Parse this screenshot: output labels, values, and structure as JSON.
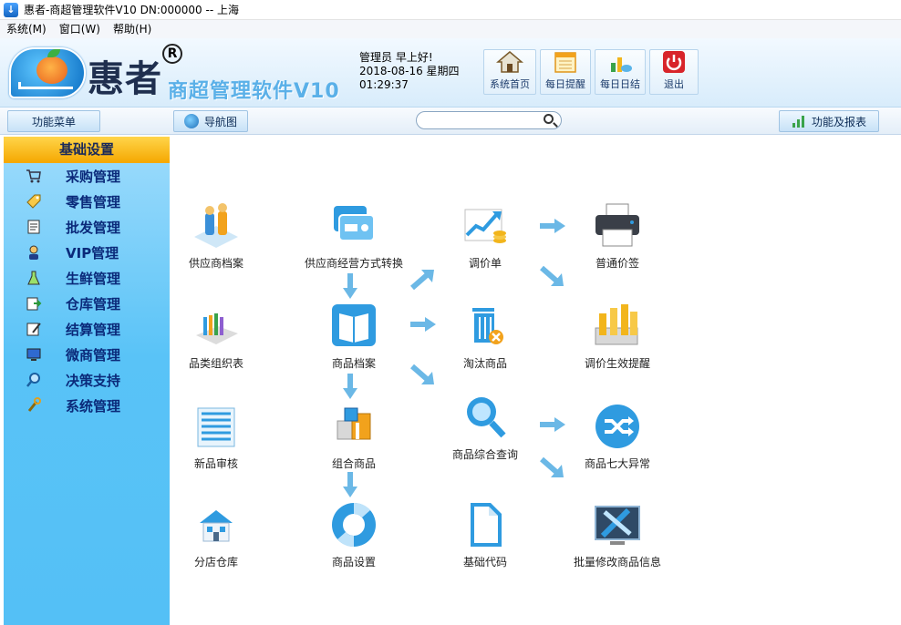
{
  "window": {
    "title": "惠者-商超管理软件V10 DN:000000 -- 上海"
  },
  "menu": [
    "系统(M)",
    "窗口(W)",
    "帮助(H)"
  ],
  "brand": {
    "name": "惠者",
    "reg": "R",
    "subtitle": "商超管理软件V10"
  },
  "greeting": {
    "user_line": "管理员  早上好!",
    "date_line": "2018-08-16  星期四",
    "time_line": "01:29:37"
  },
  "top_buttons": [
    {
      "label": "系统首页",
      "icon": "home-icon"
    },
    {
      "label": "每日提醒",
      "icon": "calendar-icon"
    },
    {
      "label": "每日日结",
      "icon": "daily-chart-icon"
    },
    {
      "label": "退出",
      "icon": "power-icon"
    }
  ],
  "toolbar": {
    "menu_label": "功能菜单",
    "nav_label": "导航图",
    "search_value": "",
    "report_label": "功能及报表"
  },
  "sidebar": {
    "header": "基础设置",
    "items": [
      {
        "label": "采购管理",
        "icon": "cart-icon"
      },
      {
        "label": "零售管理",
        "icon": "tag-icon"
      },
      {
        "label": "批发管理",
        "icon": "document-icon"
      },
      {
        "label": "VIP管理",
        "icon": "person-icon"
      },
      {
        "label": "生鲜管理",
        "icon": "flask-icon"
      },
      {
        "label": "仓库管理",
        "icon": "warehouse-icon"
      },
      {
        "label": "结算管理",
        "icon": "edit-icon"
      },
      {
        "label": "微商管理",
        "icon": "monitor-icon"
      },
      {
        "label": "决策支持",
        "icon": "search-icon"
      },
      {
        "label": "系统管理",
        "icon": "wrench-icon"
      }
    ]
  },
  "nav": {
    "col1": [
      {
        "label": "供应商档案",
        "icon": "supplier-icon"
      },
      {
        "label": "品类组织表",
        "icon": "category-icon"
      },
      {
        "label": "新品审核",
        "icon": "list-icon"
      },
      {
        "label": "分店仓库",
        "icon": "house-icon"
      }
    ],
    "col2": [
      {
        "label": "供应商经营方式转换",
        "icon": "cards-icon"
      },
      {
        "label": "商品档案",
        "icon": "book-icon"
      },
      {
        "label": "组合商品",
        "icon": "boxes-icon"
      },
      {
        "label": "商品设置",
        "icon": "lifebuoy-icon"
      }
    ],
    "col3": [
      {
        "label": "调价单",
        "icon": "trend-icon"
      },
      {
        "label": "淘汰商品",
        "icon": "trash-icon"
      },
      {
        "label": "商品综合查询",
        "icon": "magnifier-icon"
      },
      {
        "label": "基础代码",
        "icon": "file-icon"
      }
    ],
    "col4": [
      {
        "label": "普通价签",
        "icon": "printer-icon"
      },
      {
        "label": "调价生效提醒",
        "icon": "coins-icon"
      },
      {
        "label": "商品七大异常",
        "icon": "shuffle-icon"
      },
      {
        "label": "批量修改商品信息",
        "icon": "tools-icon"
      }
    ]
  },
  "colors": {
    "sidebar_top": "#9fdcfc",
    "sidebar_bottom": "#54c0f6",
    "sidebar_header": "#f5a700",
    "sidebar_text": "#0b2a7a",
    "arrow": "#6bb8e6",
    "icon_blue": "#2f9be0"
  }
}
